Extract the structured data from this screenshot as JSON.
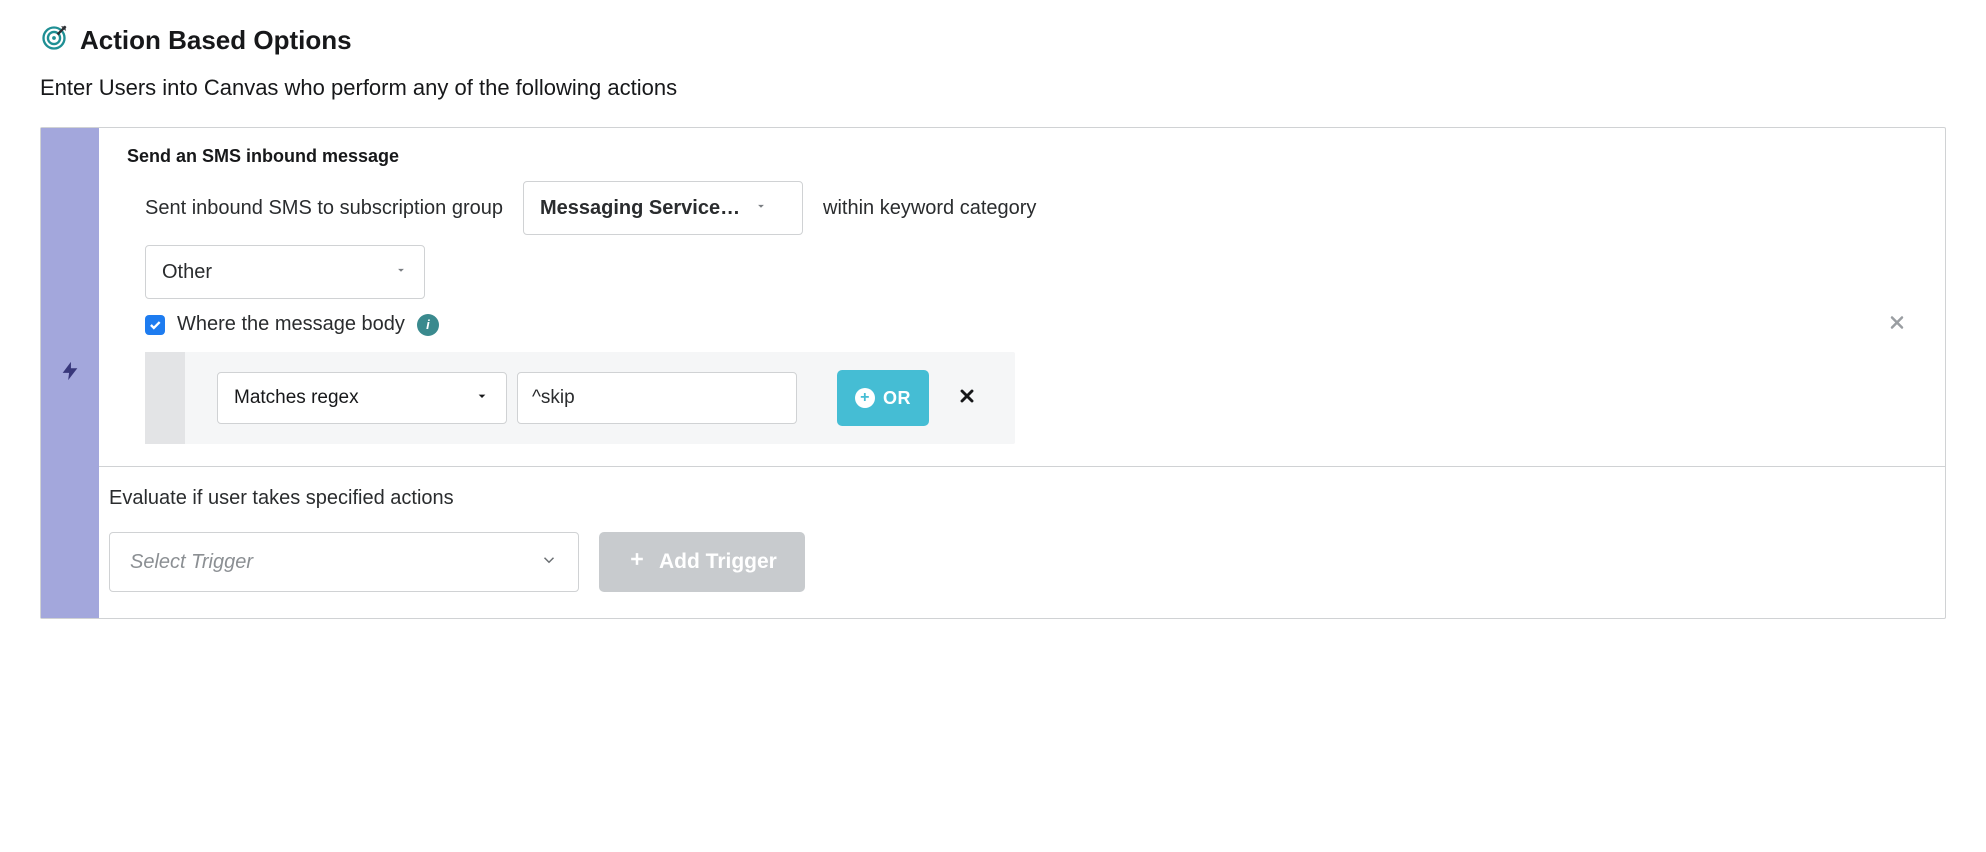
{
  "header": {
    "title": "Action Based Options"
  },
  "subtitle": "Enter Users into Canvas who perform any of the following actions",
  "trigger": {
    "title": "Send an SMS inbound message",
    "text_before_group": "Sent inbound SMS to subscription group",
    "group_select": "Messaging Service…",
    "text_after_group": "within keyword category",
    "category_select": "Other",
    "checkbox_label": "Where the message body",
    "filter": {
      "operator": "Matches regex",
      "value": "^skip",
      "or_label": "OR"
    }
  },
  "evaluate": {
    "text": "Evaluate if user takes specified actions",
    "select_placeholder": "Select Trigger",
    "add_button": "Add Trigger"
  }
}
